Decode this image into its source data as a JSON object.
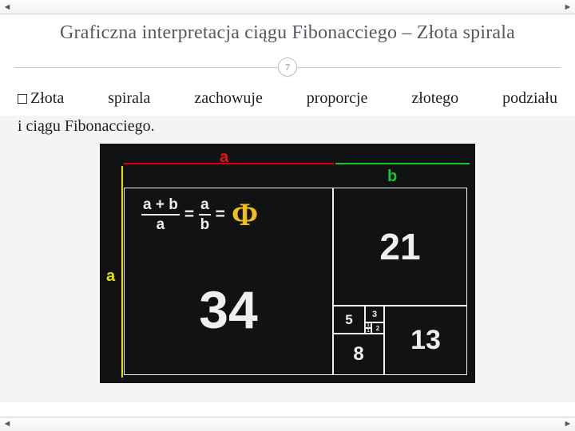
{
  "title": "Graficzna interpretacja ciągu Fibonacciego – Złota spirala",
  "slide_number": "7",
  "bullet": {
    "w1": "Złota",
    "w2": "spirala",
    "w3": "zachowuje",
    "w4": "proporcje",
    "w5": "złotego",
    "w6": "podziału"
  },
  "line2": "i ciągu Fibonacciego.",
  "fig": {
    "a_top": "a",
    "b_top": "b",
    "a_left": "a",
    "eq_frac1_num": "a + b",
    "eq_frac1_den": "a",
    "eq_eq1": "=",
    "eq_frac2_num": "a",
    "eq_frac2_den": "b",
    "eq_eq2": "=",
    "phi": "Φ",
    "sq34": "34",
    "sq21": "21",
    "sq13": "13",
    "sq8": "8",
    "sq5": "5",
    "sq3": "3",
    "sq2": "2",
    "sq1a": "1",
    "sq1b": "1"
  },
  "nav": {
    "prev": "◄",
    "next": "►"
  }
}
